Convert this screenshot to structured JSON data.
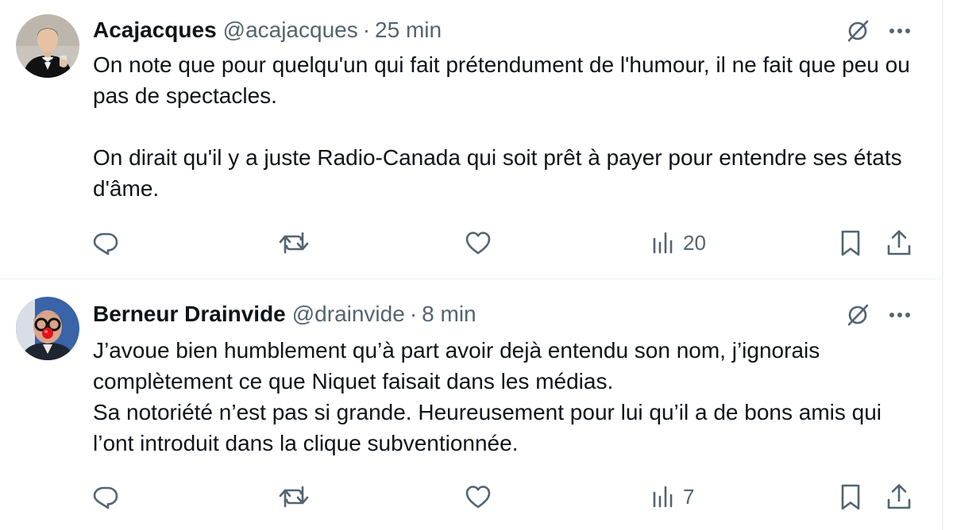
{
  "tweets": [
    {
      "display_name": "Acajacques",
      "handle": "@acajacques",
      "separator": "·",
      "time": "25 min",
      "paragraphs": [
        "On note que pour quelqu'un qui fait prétendument de l'humour, il ne fait que peu ou pas de spectacles.",
        "On dirait qu'il y a juste Radio-Canada qui soit prêt à payer pour entendre ses états d'âme."
      ],
      "views": "20",
      "avatar": "man-in-tuxedo-photo"
    },
    {
      "display_name": "Berneur Drainvide",
      "handle": "@drainvide",
      "separator": "·",
      "time": "8 min",
      "paragraphs": [
        "J’avoue bien humblement qu’à part avoir dejà entendu son nom, j’ignorais complètement ce que Niquet faisait dans les médias.",
        "Sa notoriété n’est pas si grande. Heureusement pour lui qu’il a de bons amis qui l’ont introduit dans la clique subventionnée."
      ],
      "views": "7",
      "avatar": "man-with-glasses-and-clown-nose-photo"
    }
  ],
  "icons": {
    "reply": "reply-icon",
    "retweet": "retweet-icon",
    "like": "heart-icon",
    "views": "views-bar-chart-icon",
    "bookmark": "bookmark-icon",
    "share": "share-icon",
    "grok": "grok-icon",
    "more": "more-icon"
  },
  "colors": {
    "text": "#0f1419",
    "secondary": "#536471",
    "border": "#eff3f4"
  }
}
